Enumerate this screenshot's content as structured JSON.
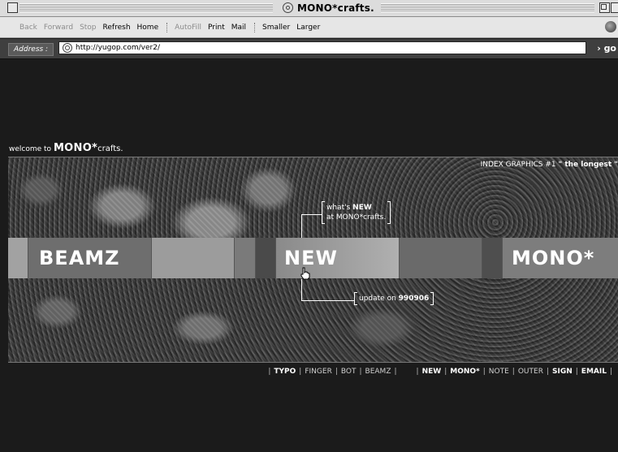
{
  "window": {
    "title": "MONO*crafts."
  },
  "toolbar": {
    "buttons": [
      {
        "label": "Back",
        "enabled": false
      },
      {
        "label": "Forward",
        "enabled": false
      },
      {
        "label": "Stop",
        "enabled": false
      },
      {
        "label": "Refresh",
        "enabled": true
      },
      {
        "label": "Home",
        "enabled": true
      },
      {
        "label": "AutoFill",
        "enabled": false
      },
      {
        "label": "Print",
        "enabled": true
      },
      {
        "label": "Mail",
        "enabled": true
      },
      {
        "label": "Smaller",
        "enabled": true
      },
      {
        "label": "Larger",
        "enabled": true
      }
    ]
  },
  "address": {
    "label": "Address :",
    "url": "http://yugop.com/ver2/",
    "go_label": "go"
  },
  "page": {
    "welcome_prefix": "welcome to",
    "welcome_brand": "MONO*",
    "welcome_suffix": "crafts.",
    "index_graphics": "INDEX GRAPHICS #1",
    "index_graphics_quote": "\" the longest \"",
    "whats_new_line1_prefix": "what's",
    "whats_new_line1_bold": "NEW",
    "whats_new_line2": "at MONO*crafts.",
    "update_prefix": "update on",
    "update_date": "990906",
    "strip": {
      "labels": [
        "BEAMZ",
        "NEW",
        "MONO*"
      ]
    },
    "bottom_nav_left": [
      "TYPO",
      "FINGER",
      "BOT",
      "BEAMZ"
    ],
    "bottom_nav_right": [
      "NEW",
      "MONO*",
      "NOTE",
      "OUTER",
      "SIGN",
      "EMAIL"
    ]
  },
  "colors": {
    "background": "#1b1b1b",
    "text": "#ffffff",
    "toolbar": "#e6e6e6"
  }
}
